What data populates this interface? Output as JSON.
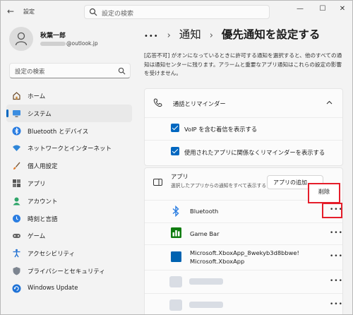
{
  "window": {
    "app_title": "設定",
    "search_placeholder": "設定の検索",
    "min_glyph": "—",
    "max_glyph": "☐",
    "close_glyph": "✕"
  },
  "user": {
    "name": "秋葉一郎",
    "email_domain": "@outlook.jp"
  },
  "sidebar": {
    "search_placeholder": "設定の検索",
    "items": [
      {
        "label": "ホーム",
        "icon": "home-icon"
      },
      {
        "label": "システム",
        "icon": "system-icon",
        "selected": true
      },
      {
        "label": "Bluetooth とデバイス",
        "icon": "bluetooth-icon"
      },
      {
        "label": "ネットワークとインターネット",
        "icon": "network-icon"
      },
      {
        "label": "個人用設定",
        "icon": "brush-icon"
      },
      {
        "label": "アプリ",
        "icon": "apps-icon"
      },
      {
        "label": "アカウント",
        "icon": "account-icon"
      },
      {
        "label": "時刻と言語",
        "icon": "clock-icon"
      },
      {
        "label": "ゲーム",
        "icon": "gamepad-icon"
      },
      {
        "label": "アクセシビリティ",
        "icon": "accessibility-icon"
      },
      {
        "label": "プライバシーとセキュリティ",
        "icon": "shield-icon"
      },
      {
        "label": "Windows Update",
        "icon": "update-icon"
      }
    ]
  },
  "breadcrumb": {
    "overflow": "•••",
    "sep": "›",
    "parent": "通知",
    "current": "優先通知を設定する"
  },
  "description": "[応答不可] がオンになっているときに許可する通知を選択すると、他のすべての通知は通知センターに残ります。アラームと重要なアプリ通知はこれらの設定の影響を受けません。",
  "calls": {
    "title": "通話とリマインダー",
    "options": [
      {
        "label": "VoIP を含む着信を表示する",
        "checked": true
      },
      {
        "label": "使用されたアプリに関係なくリマインダーを表示する",
        "checked": true
      }
    ]
  },
  "apps": {
    "title": "アプリ",
    "subtitle": "選択したアプリからの通知をすべて表示する",
    "add_button": "アプリの追加",
    "context_menu_delete": "削除",
    "more": "•••",
    "items": [
      {
        "name": "Bluetooth",
        "icon": "bluetooth-icon"
      },
      {
        "name": "Game Bar",
        "icon": "game-bar-icon"
      },
      {
        "name": "Microsoft.XboxApp_8wekyb3d8bbwe!",
        "name2": "Microsoft.XboxApp",
        "icon": "xbox-app-icon"
      }
    ]
  },
  "colors": {
    "accent": "#0067c0",
    "highlight_red": "#e51e2b"
  }
}
